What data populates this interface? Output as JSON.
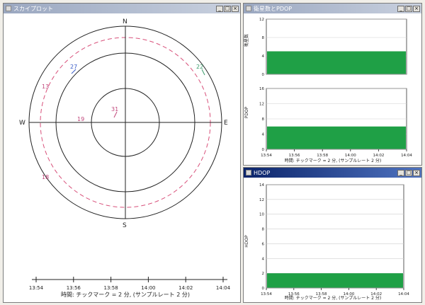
{
  "skyplot": {
    "title": "スカイプロット",
    "compass": {
      "n": "N",
      "s": "S",
      "e": "E",
      "w": "W"
    },
    "satellites": [
      {
        "id": "27",
        "color": "#3a5cc7"
      },
      {
        "id": "22",
        "color": "#3a9a6a"
      },
      {
        "id": "13",
        "color": "#c0457a"
      },
      {
        "id": "19",
        "color": "#c0457a"
      },
      {
        "id": "31",
        "color": "#c0457a"
      },
      {
        "id": "18",
        "color": "#c0457a"
      }
    ],
    "timeline": {
      "ticks": [
        "13:54",
        "13:56",
        "13:58",
        "14:00",
        "14:02",
        "14:04"
      ],
      "caption": "時間: チックマーク = 2 分, (サンプルレート 2 分)"
    }
  },
  "sats_pdop": {
    "title": "衛星数とPDOP",
    "sats_chart": {
      "ylabel": "衛星数",
      "y_ticks": [
        "0",
        "4",
        "8",
        "12"
      ],
      "ylim": [
        0,
        12
      ],
      "value": 5,
      "color": "#1fa046"
    },
    "pdop_chart": {
      "ylabel": "PDOP",
      "y_ticks": [
        "0",
        "4",
        "8",
        "12",
        "16"
      ],
      "ylim": [
        0,
        16
      ],
      "value": 6,
      "color": "#1fa046"
    },
    "x_ticks": [
      "13:54",
      "13:56",
      "13:58",
      "14:00",
      "14:02",
      "14:04"
    ],
    "caption": "時間: チックマーク = 2 分, (サンプルレート 2 分)"
  },
  "hdop": {
    "title": "HDOP",
    "chart": {
      "ylabel": "HDOP",
      "y_ticks": [
        "0",
        "2",
        "4",
        "6",
        "8",
        "10",
        "12",
        "14"
      ],
      "ylim": [
        0,
        14
      ],
      "value": 2,
      "color": "#1fa046"
    },
    "x_ticks": [
      "13:54",
      "13:56",
      "13:58",
      "14:00",
      "14:02",
      "14:04"
    ],
    "caption": "時間: チックマーク = 2 分, (サンプルレート 2 分)"
  },
  "window_buttons": {
    "minimize": "_",
    "maximize": "□",
    "close": "×"
  },
  "chart_data": [
    {
      "type": "bar",
      "ylabel": "衛星数",
      "x": [
        "13:54",
        "13:56",
        "13:58",
        "14:00",
        "14:02",
        "14:04"
      ],
      "values": [
        5,
        5,
        5,
        5,
        5,
        5
      ],
      "ylim": [
        0,
        12
      ]
    },
    {
      "type": "bar",
      "ylabel": "PDOP",
      "x": [
        "13:54",
        "13:56",
        "13:58",
        "14:00",
        "14:02",
        "14:04"
      ],
      "values": [
        6,
        6,
        6,
        6,
        6,
        6
      ],
      "ylim": [
        0,
        16
      ]
    },
    {
      "type": "bar",
      "ylabel": "HDOP",
      "x": [
        "13:54",
        "13:56",
        "13:58",
        "14:00",
        "14:02",
        "14:04"
      ],
      "values": [
        2,
        2,
        2,
        2,
        2,
        2
      ],
      "ylim": [
        0,
        14
      ]
    }
  ]
}
